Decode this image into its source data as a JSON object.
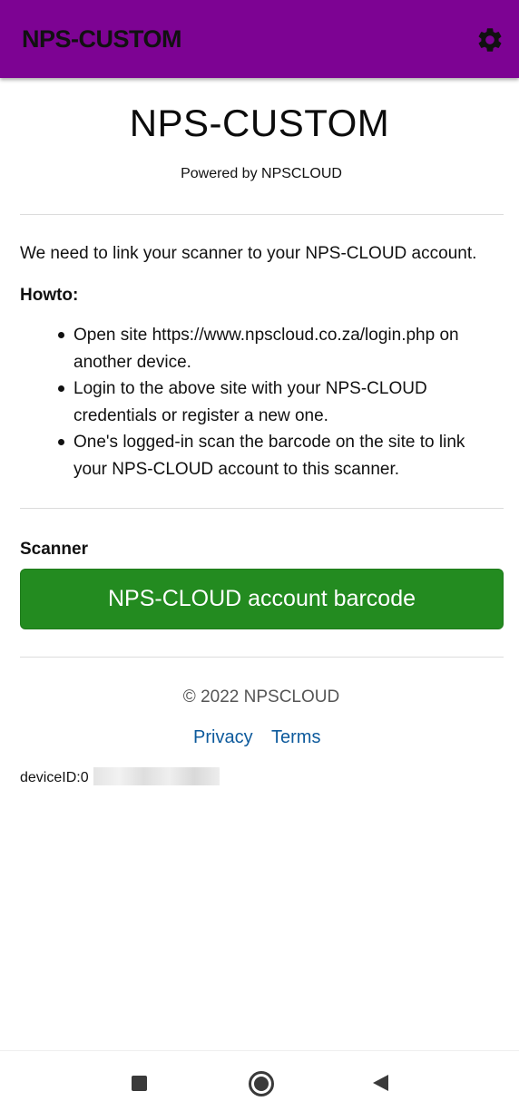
{
  "appbar": {
    "title": "NPS-CUSTOM",
    "settings_icon": "gear-icon",
    "background_color": "#7d0393"
  },
  "header": {
    "title": "NPS-CUSTOM",
    "powered_by": "Powered by NPSCLOUD"
  },
  "content": {
    "intro": "We need to link your scanner to your NPS-CLOUD account.",
    "howto_heading": "Howto:",
    "steps": [
      {
        "line1": "Open site https://www.npscloud.co.za/login.php on",
        "line2": "another device."
      },
      {
        "line1": "Login to the above site with your NPS-CLOUD",
        "line2": "credentials or register a new one."
      },
      {
        "line1": "One's logged-in scan the barcode on the site to link",
        "line2": "your NPS-CLOUD account to this scanner."
      }
    ]
  },
  "scanner": {
    "label": "Scanner",
    "button_label": "NPS-CLOUD account barcode",
    "button_color": "#238b20"
  },
  "footer": {
    "copyright": "© 2022 NPSCLOUD",
    "privacy": "Privacy",
    "terms": "Terms",
    "link_color": "#0d5a9c"
  },
  "device": {
    "label": "deviceID:0"
  },
  "navbar": {
    "recents_icon": "square-icon",
    "home_icon": "home-circle-icon",
    "back_icon": "back-triangle-icon"
  }
}
